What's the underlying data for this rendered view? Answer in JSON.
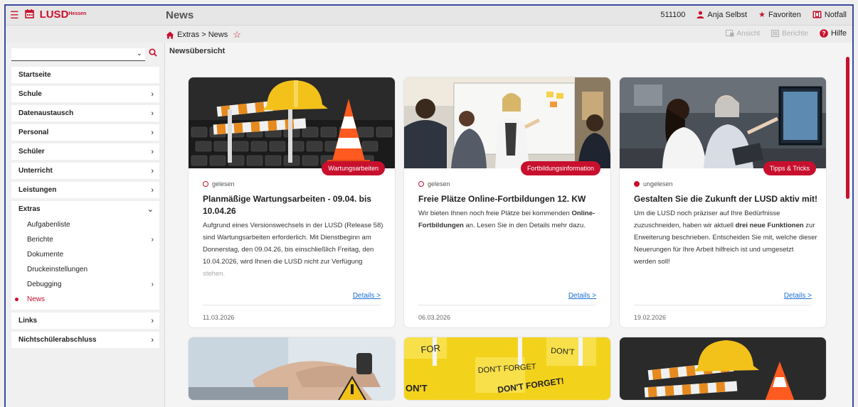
{
  "app": {
    "logo": "LUSD",
    "logo_sup": "Hessen",
    "page_title": "News"
  },
  "topbar": {
    "user_id": "511100",
    "user_name": "Anja Selbst",
    "favorites": "Favoriten",
    "notfall": "Notfall"
  },
  "breadcrumb": {
    "path": "Extras > News"
  },
  "toolbar": {
    "ansicht": "Ansicht",
    "berichte": "Berichte",
    "hilfe": "Hilfe"
  },
  "sidebar": {
    "items": [
      {
        "label": "Startseite"
      },
      {
        "label": "Schule"
      },
      {
        "label": "Datenaustausch"
      },
      {
        "label": "Personal"
      },
      {
        "label": "Schüler"
      },
      {
        "label": "Unterricht"
      },
      {
        "label": "Leistungen"
      }
    ],
    "extras": {
      "label": "Extras",
      "children": [
        {
          "label": "Aufgabenliste"
        },
        {
          "label": "Berichte"
        },
        {
          "label": "Dokumente"
        },
        {
          "label": "Druckeinstellungen"
        },
        {
          "label": "Debugging"
        },
        {
          "label": "News"
        }
      ]
    },
    "after": [
      {
        "label": "Links"
      },
      {
        "label": "Nichtschülerabschluss"
      }
    ]
  },
  "main": {
    "heading": "Newsübersicht"
  },
  "cards": [
    {
      "badge": "Wartungsarbeiten",
      "status": "gelesen",
      "title": "Planmäßige Wartungsarbeiten - 09.04. bis 10.04.26",
      "text1": "Aufgrund eines Versionswechsels in der LUSD (Release 58) sind Wartungsarbeiten erforderlich. Mit Dienstbeginn am Donnerstag, den 09.04.26, bis einschließlich Freitag, den 10.04.2026, wird Ihnen die LUSD nicht zur Verfügung",
      "text2": "stehen.",
      "details": "Details >",
      "date": "11.03.2026"
    },
    {
      "badge": "Fortbildungsinformation",
      "status": "gelesen",
      "title": "Freie Plätze Online-Fortbildungen 12. KW",
      "text_a": "Wir bieten Ihnen noch freie Plätze bei kommenden ",
      "text_b": "Online-Fortbildungen",
      "text_c": " an. Lesen Sie in den Details mehr dazu.",
      "details": "Details >",
      "date": "06.03.2026"
    },
    {
      "badge": "Tipps & Tricks",
      "status": "ungelesen",
      "title": "Gestalten Sie die Zukunft der LUSD aktiv mit!",
      "text_a": "Um die LUSD noch präziser auf Ihre Bedürfnisse zuzuschneiden, haben wir aktuell ",
      "text_b": "drei neue Funktionen",
      "text_c": " zur Erweiterung beschrieben. Entscheiden Sie mit, welche dieser Neuerungen für Ihre Arbeit hilfreich ist und umgesetzt werden soll!",
      "details": "Details >",
      "date": "19.02.2026"
    }
  ],
  "sticky_notes": {
    "note1": "FOR",
    "note2": "DON'T FORGET",
    "note3": "DON'T",
    "note4": "DON'T FORGET!",
    "note5": "ON'T"
  },
  "colors": {
    "accent": "#c8102e",
    "link": "#1b6fd0",
    "frame": "#3a4ba0"
  }
}
